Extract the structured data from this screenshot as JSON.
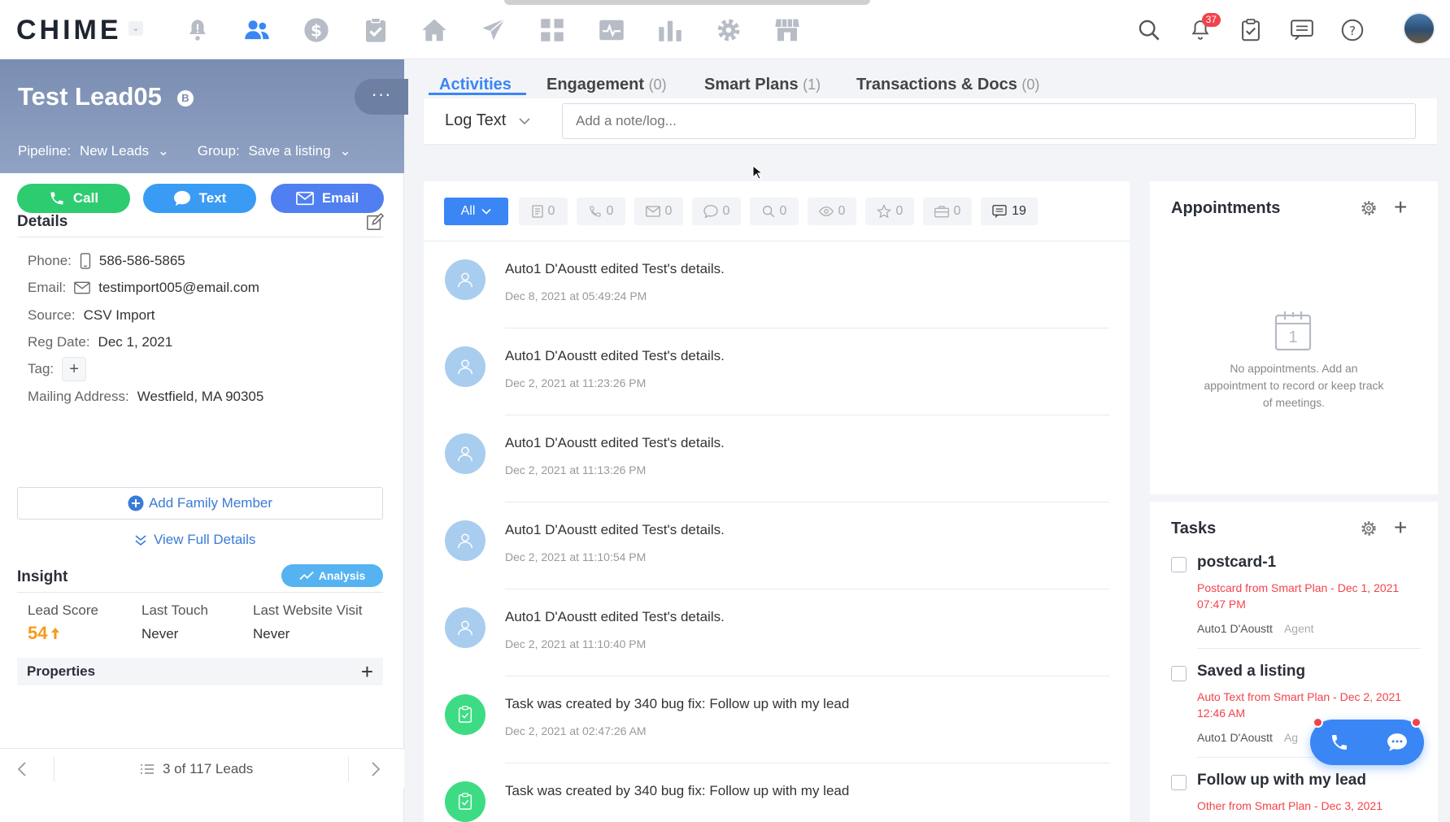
{
  "topbar": {
    "logo": "CHIME",
    "logo_caret": "⌄",
    "nav_icons": [
      "bell-alert-icon",
      "people-icon",
      "dollar-icon",
      "clipboard-check-icon",
      "home-icon",
      "paper-plane-icon",
      "grid-icon",
      "pulse-icon",
      "bar-chart-icon",
      "gear-icon",
      "storefront-icon"
    ],
    "notification_count": "37"
  },
  "lead": {
    "name": "Test Lead05",
    "badge": "B",
    "more": "···",
    "pipeline_label": "Pipeline:",
    "pipeline_value": "New Leads",
    "group_label": "Group:",
    "group_value": "Save a listing",
    "actions": {
      "call": "Call",
      "text": "Text",
      "email": "Email"
    }
  },
  "details": {
    "title": "Details",
    "phone_label": "Phone:",
    "phone": "586-586-5865",
    "email_label": "Email:",
    "email": "testimport005@email.com",
    "source_label": "Source:",
    "source": "CSV Import",
    "regdate_label": "Reg Date:",
    "regdate": "Dec 1, 2021",
    "tag_label": "Tag:",
    "tag_add": "+",
    "address_label": "Mailing Address:",
    "address": "Westfield, MA 90305",
    "add_family": "Add Family Member",
    "view_full": "View Full Details"
  },
  "insight": {
    "title": "Insight",
    "analysis": "Analysis",
    "lead_score_label": "Lead Score",
    "lead_score": "54",
    "last_touch_label": "Last Touch",
    "last_touch": "Never",
    "last_visit_label": "Last Website Visit",
    "last_visit": "Never",
    "properties": "Properties",
    "properties_add": "+"
  },
  "pager": {
    "text": "3 of 117 Leads"
  },
  "tabs": [
    {
      "label": "Activities",
      "count": ""
    },
    {
      "label": "Engagement",
      "count": "(0)"
    },
    {
      "label": "Smart Plans",
      "count": "(1)"
    },
    {
      "label": "Transactions & Docs",
      "count": "(0)"
    }
  ],
  "log": {
    "type": "Log Text",
    "placeholder": "Add a note/log..."
  },
  "filters": {
    "all": "All",
    "chips": [
      {
        "icon": "note-icon",
        "count": "0"
      },
      {
        "icon": "phone-icon",
        "count": "0"
      },
      {
        "icon": "mail-icon",
        "count": "0"
      },
      {
        "icon": "chat-icon",
        "count": "0"
      },
      {
        "icon": "search-icon",
        "count": "0"
      },
      {
        "icon": "eye-icon",
        "count": "0"
      },
      {
        "icon": "star-icon",
        "count": "0"
      },
      {
        "icon": "briefcase-icon",
        "count": "0"
      },
      {
        "icon": "message-icon",
        "count": "19"
      }
    ]
  },
  "activities": [
    {
      "kind": "user",
      "text": "Auto1 D'Aoustt edited Test's details.",
      "time": "Dec 8, 2021 at 05:49:24 PM"
    },
    {
      "kind": "user",
      "text": "Auto1 D'Aoustt edited Test's details.",
      "time": "Dec 2, 2021 at 11:23:26 PM"
    },
    {
      "kind": "user",
      "text": "Auto1 D'Aoustt edited Test's details.",
      "time": "Dec 2, 2021 at 11:13:26 PM"
    },
    {
      "kind": "user",
      "text": "Auto1 D'Aoustt edited Test's details.",
      "time": "Dec 2, 2021 at 11:10:54 PM"
    },
    {
      "kind": "user",
      "text": "Auto1 D'Aoustt edited Test's details.",
      "time": "Dec 2, 2021 at 11:10:40 PM"
    },
    {
      "kind": "task",
      "text": "Task was created by 340 bug fix: Follow up with my lead",
      "time": "Dec 2, 2021 at 02:47:26 AM"
    },
    {
      "kind": "task",
      "text": "Task was created by 340 bug fix: Follow up with my lead",
      "time": ""
    }
  ],
  "appointments": {
    "title": "Appointments",
    "plus": "+",
    "calendar_day": "1",
    "empty": "No appointments. Add an appointment to record or keep track of meetings."
  },
  "tasks": {
    "title": "Tasks",
    "plus": "+",
    "items": [
      {
        "title": "postcard-1",
        "sub": "Postcard from Smart Plan - Dec 1, 2021 07:47 PM",
        "agent": "Auto1 D'Aoustt",
        "role": "Agent"
      },
      {
        "title": "Saved a listing",
        "sub": "Auto Text from Smart Plan - Dec 2, 2021 12:46 AM",
        "agent": "Auto1 D'Aoustt",
        "role": "Ag"
      },
      {
        "title": "Follow up with my lead",
        "sub": "Other from Smart Plan - Dec 3, 2021",
        "agent": "",
        "role": ""
      }
    ]
  },
  "colors": {
    "primary": "#3a86f5",
    "call": "#2ecc71",
    "text": "#3a9bf5",
    "email": "#4f7ff0",
    "danger": "#f2434b",
    "score": "#f59b1b"
  }
}
